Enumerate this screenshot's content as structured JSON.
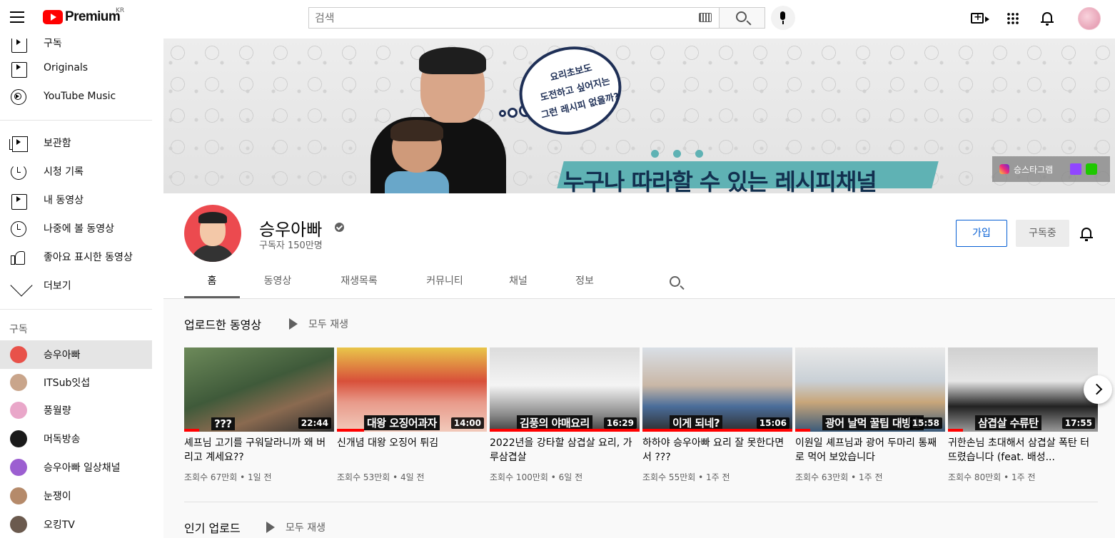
{
  "topbar": {
    "brand": "Premium",
    "region": "KR",
    "search_placeholder": "검색"
  },
  "sidebar": {
    "top_items": [
      {
        "label": "구독",
        "icon": "subscriptions-icon"
      },
      {
        "label": "Originals",
        "icon": "originals-icon"
      },
      {
        "label": "YouTube Music",
        "icon": "youtube-music-icon"
      }
    ],
    "library_items": [
      {
        "label": "보관함",
        "icon": "library-icon"
      },
      {
        "label": "시청 기록",
        "icon": "history-icon"
      },
      {
        "label": "내 동영상",
        "icon": "my-videos-icon"
      },
      {
        "label": "나중에 볼 동영상",
        "icon": "watch-later-icon"
      },
      {
        "label": "좋아요 표시한 동영상",
        "icon": "liked-videos-icon"
      },
      {
        "label": "더보기",
        "icon": "chevron-down-icon"
      }
    ],
    "subscriptions_title": "구독",
    "subscriptions": [
      {
        "label": "승우아빠",
        "color": "#e8524a"
      },
      {
        "label": "ITSub잇섭",
        "color": "#c9a58b"
      },
      {
        "label": "풍월량",
        "color": "#e9a7c9"
      },
      {
        "label": "머독방송",
        "color": "#1a1a1a"
      },
      {
        "label": "승우아빠 일상채널",
        "color": "#9c5fd1"
      },
      {
        "label": "눈쟁이",
        "color": "#b58a6a"
      },
      {
        "label": "오킹TV",
        "color": "#6b5a4e"
      }
    ]
  },
  "banner": {
    "bubble_lines": [
      "요리초보도",
      "도전하고 싶어지는",
      "그런 레시피 없을까?"
    ],
    "slogan": "누구나 따라할 수 있는 레시피채널",
    "instagram_label": "승스타그램"
  },
  "channel": {
    "name": "승우아빠",
    "subscribers": "구독자 150만명",
    "join_label": "가입",
    "subscribed_label": "구독중",
    "tabs": [
      "홈",
      "동영상",
      "재생목록",
      "커뮤니티",
      "채널",
      "정보"
    ]
  },
  "sections": {
    "uploads_title": "업로드한 동영상",
    "play_all": "모두 재생",
    "popular_title": "인기 업로드"
  },
  "videos": [
    {
      "title": "셰프님 고기를 구워달라니까 왜 버리고 계세요??",
      "views": "조회수 67만회",
      "age": "1일 전",
      "duration": "22:44",
      "caption": "???",
      "progress": 0.1
    },
    {
      "title": "신개념 대왕 오징어 튀김",
      "views": "조회수 53만회",
      "age": "4일 전",
      "duration": "14:00",
      "caption": "대왕 오징어과자",
      "progress": 0.18
    },
    {
      "title": "2022년을 강타할 삼겹살 요리, 가루삼겹살",
      "views": "조회수 100만회",
      "age": "6일 전",
      "duration": "16:29",
      "caption": "김풍의 야매요리",
      "progress": 1.0
    },
    {
      "title": "하하야 승우아빠 요리 잘 못한다면서 ???",
      "views": "조회수 55만회",
      "age": "1주 전",
      "duration": "15:06",
      "caption": "이게 되네?",
      "progress": 1.0
    },
    {
      "title": "이원일 셰프님과 광어 두마리 통째로 먹어 보았습니다",
      "views": "조회수 63만회",
      "age": "1주 전",
      "duration": "15:58",
      "caption": "광어 날먹 꿀팁 대방출",
      "progress": 0.1
    },
    {
      "title": "귀한손님 초대해서 삼겹살 폭탄 터뜨렸습니다 (feat. 배성...",
      "views": "조회수 80만회",
      "age": "1주 전",
      "duration": "17:55",
      "caption": "삼겹살 수류탄",
      "progress": 0.1
    }
  ]
}
